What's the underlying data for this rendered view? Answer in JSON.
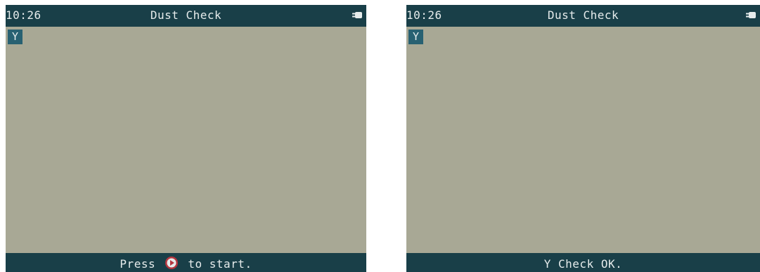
{
  "screens": [
    {
      "status_time": "10:26",
      "title": "Dust Check",
      "channel": "Y",
      "message": {
        "prefix": "Press",
        "icon": "play-button-icon",
        "suffix": "to start."
      }
    },
    {
      "status_time": "10:26",
      "title": "Dust Check",
      "channel": "Y",
      "message": {
        "text": "Y Check OK."
      }
    }
  ],
  "icons": {
    "power": "power-plug-icon",
    "play": "play-button-icon"
  },
  "colors": {
    "bar_background": "#193f48",
    "screen_background": "#a8a895",
    "channel_badge": "#286172",
    "play_ring": "#b5363f",
    "text": "#e6ecec"
  }
}
